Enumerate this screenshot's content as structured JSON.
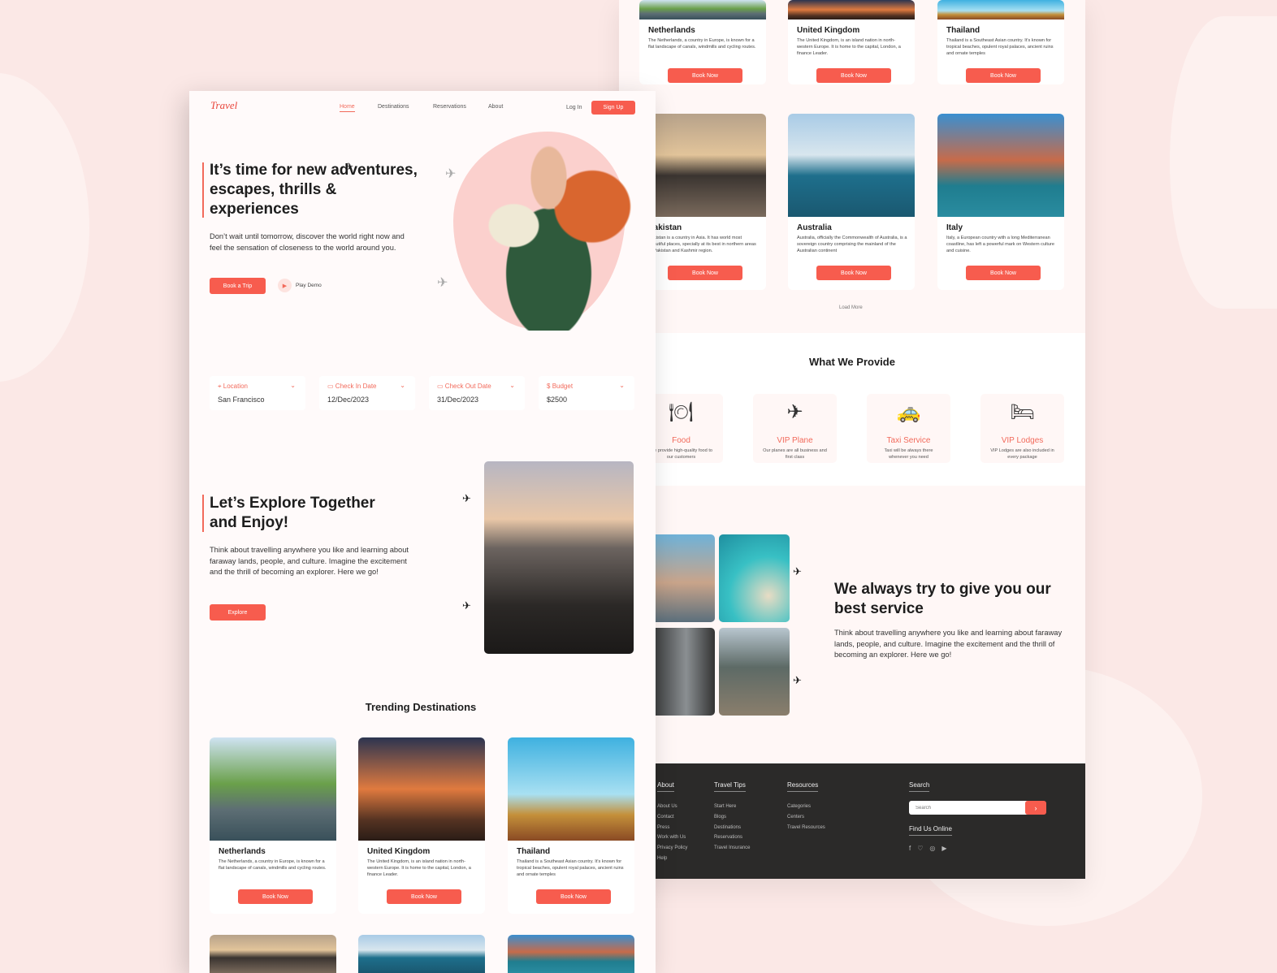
{
  "brand": {
    "logo": "Travel",
    "accent": "#f75c4e",
    "footer_bg": "#2b2a29"
  },
  "nav": {
    "items": [
      "Home",
      "Destinations",
      "Reservations",
      "About"
    ],
    "active": "Home",
    "login": "Log In",
    "signup": "Sign Up"
  },
  "hero": {
    "title": "It’s time for new adventures, escapes, thrills & experiences",
    "text": "Don’t wait until tomorrow, discover the world right now and feel the sensation of closeness to the world around you.",
    "book_trip": "Book a Trip",
    "play_demo": "Play Demo"
  },
  "search": [
    {
      "label": "Location",
      "value": "San Francisco",
      "icon": "map-pin-icon"
    },
    {
      "label": "Check In Date",
      "value": "12/Dec/2023",
      "icon": "calendar-icon"
    },
    {
      "label": "Check Out Date",
      "value": "31/Dec/2023",
      "icon": "calendar-icon"
    },
    {
      "label": "Budget",
      "value": "$2500",
      "icon": "dollar-icon"
    }
  ],
  "explore": {
    "title": "Let’s Explore Together and Enjoy!",
    "text": "Think about travelling anywhere you like and learning about faraway lands, people, and culture. Imagine the excitement and the thrill of becoming an explorer. Here we go!",
    "button": "Explore"
  },
  "trending": {
    "title": "Trending Destinations",
    "book": "Book Now",
    "load_more": "Load More"
  },
  "destinations": [
    {
      "name": "Netherlands",
      "desc": "The Netherlands, a country in Europe, is known for a flat landscape of canals, windmills and cycling routes."
    },
    {
      "name": "United Kingdom",
      "desc": "The United Kingdom, is an island nation in north-western Europe. It is home to the capital, London, a finance Leader."
    },
    {
      "name": "Thailand",
      "desc": "Thailand is a Southeast Asian country. It's known for tropical beaches, opulent royal palaces, ancient ruins and ornate temples"
    },
    {
      "name": "Pakistan",
      "desc": "Pakistan is a country in Asia. It has world most beautiful places, specially at its best in northern areas of Pakistan and Kashmir region."
    },
    {
      "name": "Australia",
      "desc": "Australia, officially the Commonwealth of Australia, is a sovereign country comprising the mainland of the Australian continent"
    },
    {
      "name": "Italy",
      "desc": "Italy, a European country with a long Mediterranean coastline, has left a powerful mark on Western culture and cuisine."
    }
  ],
  "provide": {
    "title": "What We Provide",
    "items": [
      {
        "title": "Food",
        "desc": "We provide high-quality food to our customers",
        "icon": "plate-cutlery-icon"
      },
      {
        "title": "VIP Plane",
        "desc": "Our planes are all business and first class",
        "icon": "plane-icon"
      },
      {
        "title": "Taxi Service",
        "desc": "Taxi will be always there whenever you need",
        "icon": "car-icon"
      },
      {
        "title": "VIP Lodges",
        "desc": "VIP Lodges are also included in every package",
        "icon": "bed-icon"
      }
    ]
  },
  "service": {
    "title": "We always try to give you our best service",
    "text": "Think about travelling anywhere you like and learning about faraway lands, people, and culture. Imagine the excitement and the thrill of becoming an explorer. Here we go!"
  },
  "footer": {
    "columns": [
      {
        "title": "About",
        "links": [
          "About Us",
          "Contact",
          "Press",
          "Work with Us",
          "Privacy Policy",
          "Help"
        ]
      },
      {
        "title": "Travel Tips",
        "links": [
          "Start Here",
          "Blogs",
          "Destinations",
          "Reservations",
          "Travel Insurance"
        ]
      },
      {
        "title": "Resources",
        "links": [
          "Categories",
          "Centers",
          "Travel Resources"
        ]
      }
    ],
    "search_title": "Search",
    "search_placeholder": "Search",
    "find_us": "Find Us Online",
    "social": [
      "facebook-icon",
      "twitter-icon",
      "instagram-icon",
      "youtube-icon"
    ]
  }
}
